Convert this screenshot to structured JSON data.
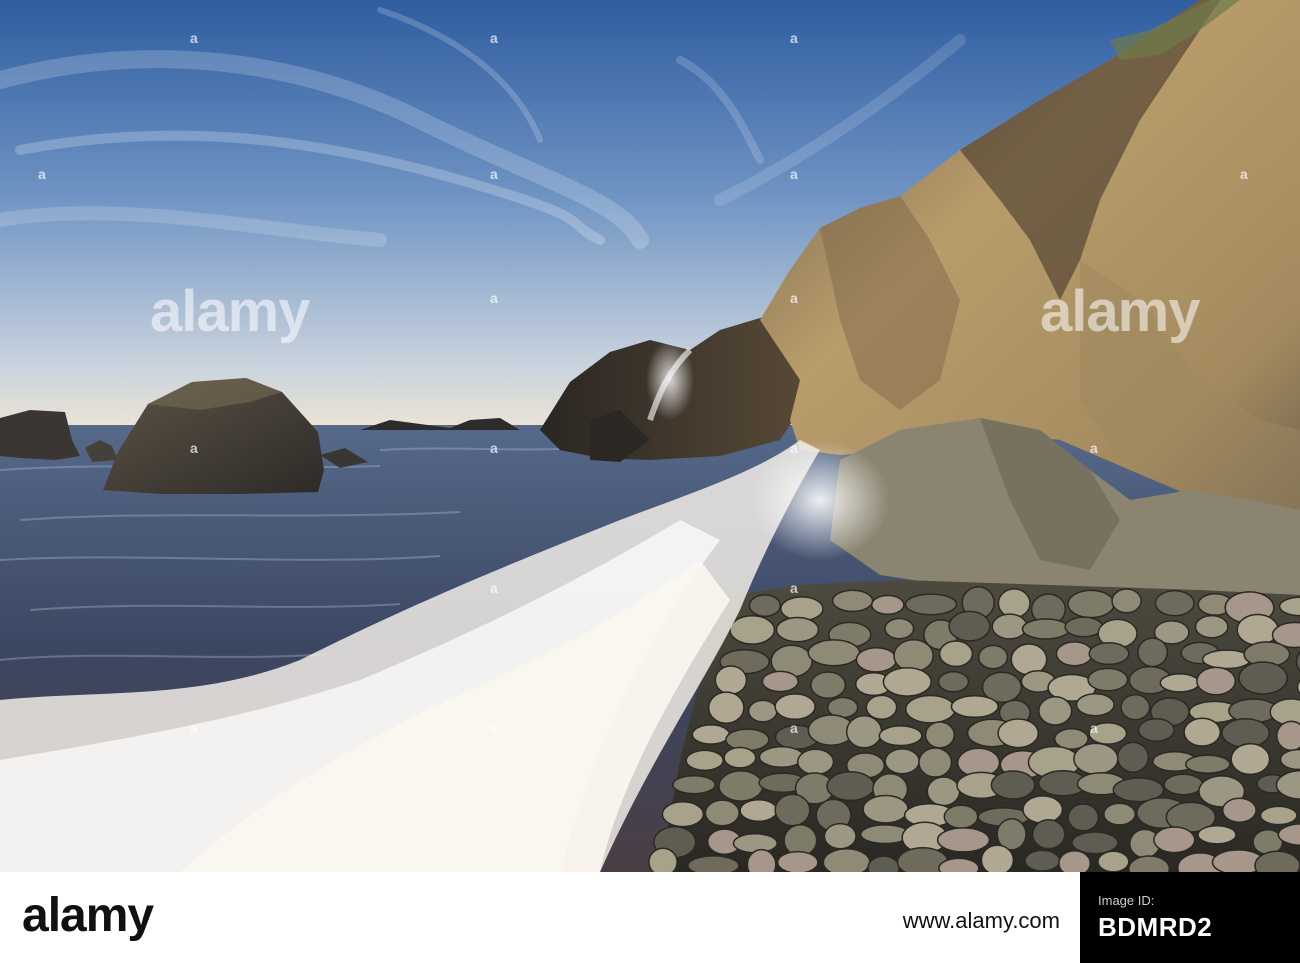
{
  "watermark": {
    "brand": "alamy",
    "dot": "a"
  },
  "footer": {
    "logo": "alamy",
    "id_label": "Image ID:",
    "image_id": "BDMRD2",
    "url": "www.alamy.com"
  },
  "colors": {
    "sky_top": "#3f6aa8",
    "sky_horizon": "#e7e4dc",
    "sea": "#3c4a63",
    "foam": "#f4f1ec",
    "cliff_lit": "#b79a69",
    "cliff_shadow": "#3a332b",
    "pebble": "#8b8774"
  }
}
